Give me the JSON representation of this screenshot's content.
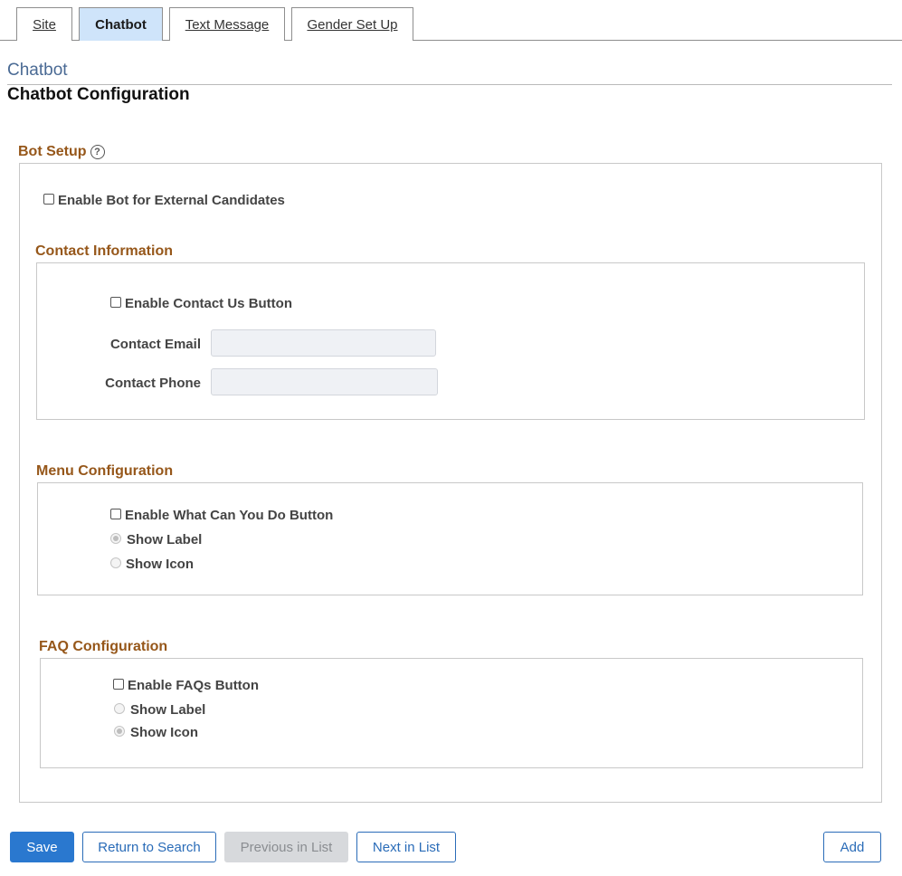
{
  "tabs": [
    {
      "label": "Site"
    },
    {
      "label": "Chatbot"
    },
    {
      "label": "Text Message"
    },
    {
      "label": "Gender Set Up"
    }
  ],
  "page": {
    "subtitle": "Chatbot",
    "title": "Chatbot Configuration"
  },
  "bot_setup": {
    "title": "Bot Setup",
    "help_glyph": "?",
    "enable_label": "Enable Bot for External Candidates",
    "enabled": false
  },
  "contact": {
    "title": "Contact Information",
    "enable_label": "Enable Contact Us Button",
    "enabled": false,
    "email_label": "Contact Email",
    "email_value": "",
    "phone_label": "Contact Phone",
    "phone_value": ""
  },
  "menu": {
    "title": "Menu Configuration",
    "enable_label": "Enable What Can You Do Button",
    "enabled": false,
    "show_label": "Show Label",
    "show_icon": "Show Icon",
    "selected": "Show Label"
  },
  "faq": {
    "title": "FAQ Configuration",
    "enable_label": "Enable FAQs Button",
    "enabled": false,
    "show_label": "Show Label",
    "show_icon": "Show Icon",
    "selected": "Show Icon"
  },
  "buttons": {
    "save": "Save",
    "return_to_search": "Return to Search",
    "previous_in_list": "Previous in List",
    "next_in_list": "Next in List",
    "add": "Add"
  },
  "colors": {
    "section_title": "#96571a",
    "active_tab": "#cfe4fa",
    "primary_button": "#2a78cf",
    "link_blue": "#2a6cb8"
  }
}
